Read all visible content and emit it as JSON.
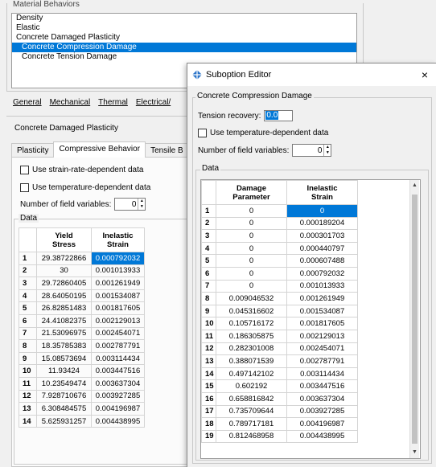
{
  "main": {
    "behaviors_title": "Material Behaviors",
    "behaviors": [
      {
        "label": "Density",
        "indent": false,
        "selected": false
      },
      {
        "label": "Elastic",
        "indent": false,
        "selected": false
      },
      {
        "label": "Concrete Damaged Plasticity",
        "indent": false,
        "selected": false
      },
      {
        "label": "Concrete Compression Damage",
        "indent": true,
        "selected": true
      },
      {
        "label": "Concrete Tension Damage",
        "indent": true,
        "selected": false
      }
    ],
    "menus": [
      "General",
      "Mechanical",
      "Thermal",
      "Electrical/"
    ],
    "section_title": "Concrete Damaged Plasticity",
    "tabs": [
      "Plasticity",
      "Compressive Behavior",
      "Tensile B"
    ],
    "strain_rate_label": "Use strain-rate-dependent data",
    "temperature_label": "Use temperature-dependent data",
    "field_vars_label": "Number of field variables:",
    "field_vars_value": "0",
    "data_title": "Data",
    "table": {
      "headers": [
        "Yield\nStress",
        "Inelastic\nStrain"
      ],
      "rows": [
        [
          "1",
          "29.38722866",
          "0.000792032"
        ],
        [
          "2",
          "30",
          "0.001013933"
        ],
        [
          "3",
          "29.72860405",
          "0.001261949"
        ],
        [
          "4",
          "28.64050195",
          "0.001534087"
        ],
        [
          "5",
          "26.82851483",
          "0.001817605"
        ],
        [
          "6",
          "24.41082375",
          "0.002129013"
        ],
        [
          "7",
          "21.53096975",
          "0.002454071"
        ],
        [
          "8",
          "18.35785383",
          "0.002787791"
        ],
        [
          "9",
          "15.08573694",
          "0.003114434"
        ],
        [
          "10",
          "11.93424",
          "0.003447516"
        ],
        [
          "11",
          "10.23549474",
          "0.003637304"
        ],
        [
          "12",
          "7.928710676",
          "0.003927285"
        ],
        [
          "13",
          "6.308484575",
          "0.004196987"
        ],
        [
          "14",
          "5.625931257",
          "0.004438995"
        ]
      ]
    }
  },
  "dialog": {
    "title": "Suboption Editor",
    "close": "×",
    "group_title": "Concrete Compression Damage",
    "tension_label": "Tension recovery:",
    "tension_value": "0.0",
    "temperature_label": "Use temperature-dependent data",
    "field_vars_label": "Number of field variables:",
    "field_vars_value": "0",
    "data_title": "Data",
    "table": {
      "headers": [
        "Damage\nParameter",
        "Inelastic\nStrain"
      ],
      "rows": [
        [
          "1",
          "0",
          "0"
        ],
        [
          "2",
          "0",
          "0.000189204"
        ],
        [
          "3",
          "0",
          "0.000301703"
        ],
        [
          "4",
          "0",
          "0.000440797"
        ],
        [
          "5",
          "0",
          "0.000607488"
        ],
        [
          "6",
          "0",
          "0.000792032"
        ],
        [
          "7",
          "0",
          "0.001013933"
        ],
        [
          "8",
          "0.009046532",
          "0.001261949"
        ],
        [
          "9",
          "0.045316602",
          "0.001534087"
        ],
        [
          "10",
          "0.105716172",
          "0.001817605"
        ],
        [
          "11",
          "0.186305875",
          "0.002129013"
        ],
        [
          "12",
          "0.282301008",
          "0.002454071"
        ],
        [
          "13",
          "0.388071539",
          "0.002787791"
        ],
        [
          "14",
          "0.497142102",
          "0.003114434"
        ],
        [
          "15",
          "0.602192",
          "0.003447516"
        ],
        [
          "16",
          "0.658816842",
          "0.003637304"
        ],
        [
          "17",
          "0.735709644",
          "0.003927285"
        ],
        [
          "18",
          "0.789717181",
          "0.004196987"
        ],
        [
          "19",
          "0.812468958",
          "0.004438995"
        ]
      ]
    }
  },
  "colors": {
    "selection": "#0078d7",
    "window_bg": "#f0f0f0"
  }
}
